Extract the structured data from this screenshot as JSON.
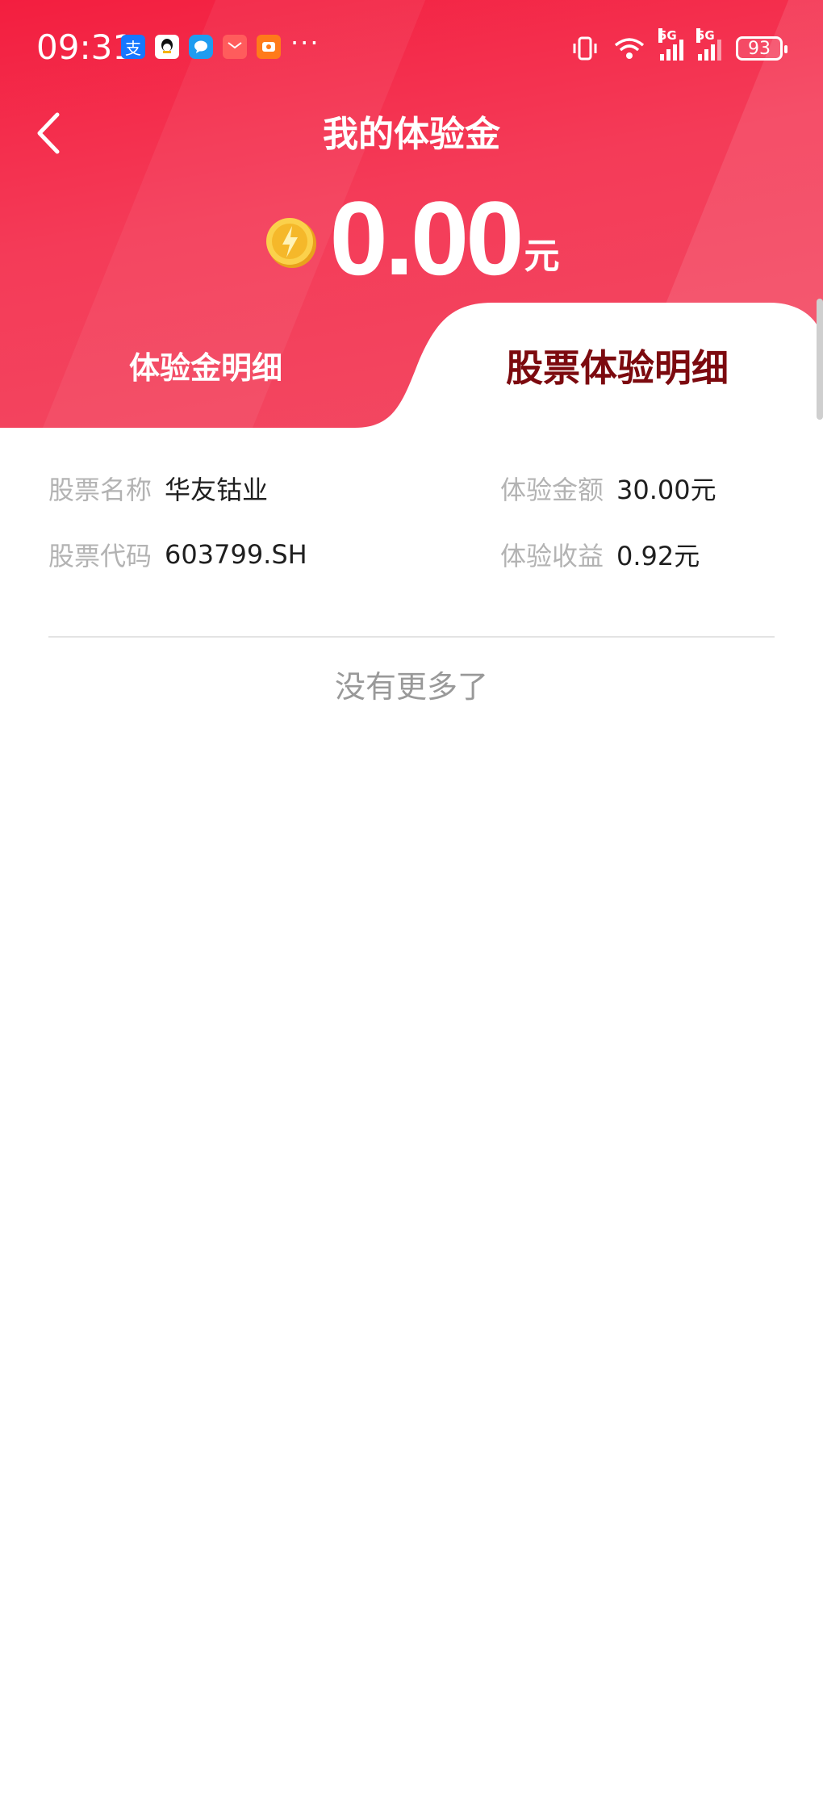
{
  "status_bar": {
    "time": "09:31",
    "battery": "93"
  },
  "header": {
    "title": "我的体验金",
    "amount": "0.00",
    "unit": "元"
  },
  "tabs": [
    {
      "label": "体验金明细",
      "active": false
    },
    {
      "label": "股票体验明细",
      "active": true
    }
  ],
  "detail": {
    "stock_name_label": "股票名称",
    "stock_name": "华友钴业",
    "stock_code_label": "股票代码",
    "stock_code": "603799.SH",
    "amount_label": "体验金额",
    "amount": "30.00元",
    "profit_label": "体验收益",
    "profit": "0.92元"
  },
  "footer_text": "没有更多了",
  "colors": {
    "header_red": "#f31e3f",
    "active_tab_text": "#7c0a0f"
  }
}
